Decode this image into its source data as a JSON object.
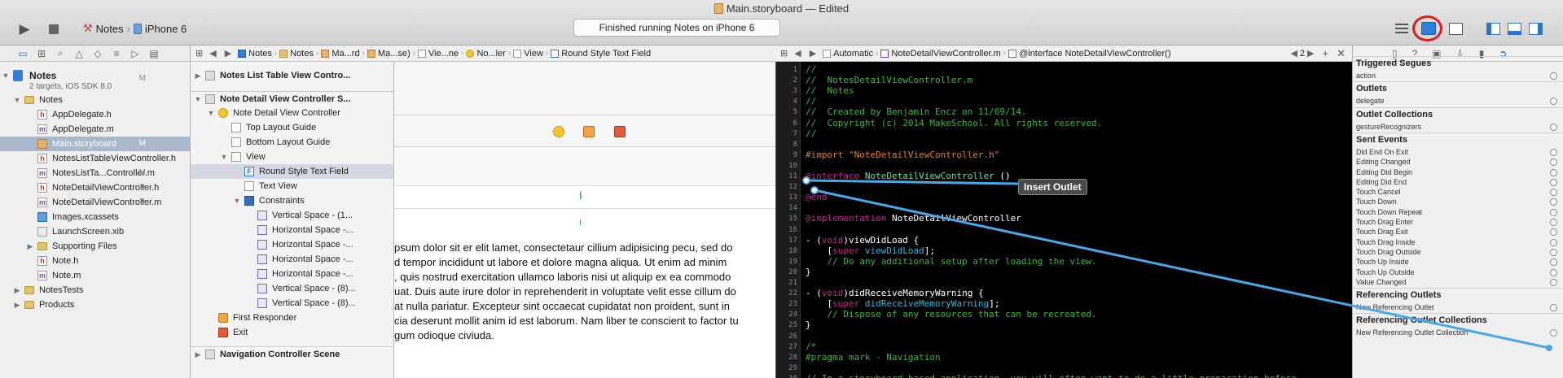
{
  "window": {
    "title": "Main.storyboard — Edited"
  },
  "toolbar": {
    "scheme_app": "Notes",
    "scheme_device": "iPhone 6",
    "activity_status": "Finished running Notes on iPhone 6"
  },
  "navigator": {
    "items": [
      {
        "label": "Notes",
        "sub": "2 targets, iOS SDK 8.0",
        "badge": "M"
      },
      {
        "label": "Notes",
        "badge": ""
      },
      {
        "label": "AppDelegate.h",
        "badge": ""
      },
      {
        "label": "AppDelegate.m",
        "badge": ""
      },
      {
        "label": "Main.storyboard",
        "badge": "M"
      },
      {
        "label": "NotesListTableViewController.h",
        "badge": ""
      },
      {
        "label": "NotesListTa...Controller.m",
        "badge": "M"
      },
      {
        "label": "NoteDetailViewController.h",
        "badge": "A"
      },
      {
        "label": "NoteDetailViewController.m",
        "badge": "A"
      },
      {
        "label": "Images.xcassets",
        "badge": ""
      },
      {
        "label": "LaunchScreen.xib",
        "badge": ""
      },
      {
        "label": "Supporting Files",
        "badge": ""
      },
      {
        "label": "Note.h",
        "badge": ""
      },
      {
        "label": "Note.m",
        "badge": ""
      },
      {
        "label": "NotesTests",
        "badge": ""
      },
      {
        "label": "Products",
        "badge": ""
      }
    ]
  },
  "ib_jumpbar": {
    "items": [
      "Notes",
      "Notes",
      "Ma...rd",
      "Ma...se)",
      "Vie...ne",
      "No...ler",
      "View",
      "Round Style Text Field"
    ]
  },
  "outline": {
    "items": [
      {
        "label": "Notes List Table View Contro..."
      },
      {
        "label": "Note Detail View Controller S..."
      },
      {
        "label": "Note Detail View Controller"
      },
      {
        "label": "Top Layout Guide"
      },
      {
        "label": "Bottom Layout Guide"
      },
      {
        "label": "View"
      },
      {
        "label": "Round Style Text Field"
      },
      {
        "label": "Text View"
      },
      {
        "label": "Constraints"
      },
      {
        "label": "Vertical Space - (1..."
      },
      {
        "label": "Horizontal Space -..."
      },
      {
        "label": "Horizontal Space -..."
      },
      {
        "label": "Horizontal Space -..."
      },
      {
        "label": "Horizontal Space -..."
      },
      {
        "label": "Vertical Space - (8)..."
      },
      {
        "label": "Vertical Space - (8)..."
      },
      {
        "label": "First Responder"
      },
      {
        "label": "Exit"
      },
      {
        "label": "Navigation Controller Scene"
      }
    ]
  },
  "canvas": {
    "text_lines": [
      "psum dolor sit er elit lamet, consectetaur cillium adipisicing pecu, sed do",
      "d tempor incididunt ut labore et dolore magna aliqua. Ut enim ad minim",
      ", quis nostrud exercitation ullamco laboris nisi ut aliquip ex ea commodo",
      "uat. Duis aute irure dolor in reprehenderit in voluptate velit esse cillum do",
      "at nulla pariatur. Excepteur sint occaecat cupidatat non proident, sunt in",
      "cia deserunt mollit anim id est laborum. Nam liber te conscient to factor tu",
      "gum odioque civiuda."
    ]
  },
  "code_jumpbar": {
    "mode": "Automatic",
    "file": "NoteDetailViewController.m",
    "symbol": "@interface NoteDetailViewController()",
    "counter": "2"
  },
  "code": {
    "lines": [
      {
        "n": "1",
        "parts": [
          {
            "c": "c-com",
            "t": "//"
          }
        ]
      },
      {
        "n": "2",
        "parts": [
          {
            "c": "c-com",
            "t": "//  NotesDetailViewController.m"
          }
        ]
      },
      {
        "n": "3",
        "parts": [
          {
            "c": "c-com",
            "t": "//  Notes"
          }
        ]
      },
      {
        "n": "4",
        "parts": [
          {
            "c": "c-com",
            "t": "//"
          }
        ]
      },
      {
        "n": "5",
        "parts": [
          {
            "c": "c-com",
            "t": "//  Created by Benjamin Encz on 11/09/14."
          }
        ]
      },
      {
        "n": "6",
        "parts": [
          {
            "c": "c-com",
            "t": "//  Copyright (c) 2014 MakeSchool. All rights reserved."
          }
        ]
      },
      {
        "n": "7",
        "parts": [
          {
            "c": "c-com",
            "t": "//"
          }
        ]
      },
      {
        "n": "8",
        "parts": []
      },
      {
        "n": "9",
        "parts": [
          {
            "c": "c-pre",
            "t": "#import "
          },
          {
            "c": "c-str",
            "t": "\"NoteDetailViewController.h\""
          }
        ]
      },
      {
        "n": "10",
        "parts": []
      },
      {
        "n": "11",
        "parts": [
          {
            "c": "c-at",
            "t": "@interface "
          },
          {
            "c": "c-cls",
            "t": "NoteDetailViewController"
          },
          {
            "c": "",
            "t": " ()"
          }
        ]
      },
      {
        "n": "12",
        "parts": []
      },
      {
        "n": "13",
        "parts": [
          {
            "c": "c-at",
            "t": "@end"
          }
        ]
      },
      {
        "n": "14",
        "parts": []
      },
      {
        "n": "15",
        "parts": [
          {
            "c": "c-at",
            "t": "@implementation "
          },
          {
            "c": "",
            "t": "NoteDetailViewController"
          }
        ]
      },
      {
        "n": "16",
        "parts": []
      },
      {
        "n": "17",
        "parts": [
          {
            "c": "",
            "t": "- ("
          },
          {
            "c": "c-kw",
            "t": "void"
          },
          {
            "c": "",
            "t": ")viewDidLoad {"
          }
        ]
      },
      {
        "n": "18",
        "parts": [
          {
            "c": "",
            "t": "    ["
          },
          {
            "c": "c-kw",
            "t": "super"
          },
          {
            "c": "c-sup",
            "t": " viewDidLoad"
          },
          {
            "c": "",
            "t": "];"
          }
        ]
      },
      {
        "n": "19",
        "parts": [
          {
            "c": "c-com",
            "t": "    // Do any additional setup after loading the view."
          }
        ]
      },
      {
        "n": "20",
        "parts": [
          {
            "c": "",
            "t": "}"
          }
        ]
      },
      {
        "n": "21",
        "parts": []
      },
      {
        "n": "22",
        "parts": [
          {
            "c": "",
            "t": "- ("
          },
          {
            "c": "c-kw",
            "t": "void"
          },
          {
            "c": "",
            "t": ")didReceiveMemoryWarning {"
          }
        ]
      },
      {
        "n": "23",
        "parts": [
          {
            "c": "",
            "t": "    ["
          },
          {
            "c": "c-kw",
            "t": "super"
          },
          {
            "c": "c-sup",
            "t": " didReceiveMemoryWarning"
          },
          {
            "c": "",
            "t": "];"
          }
        ]
      },
      {
        "n": "24",
        "parts": [
          {
            "c": "c-com",
            "t": "    // Dispose of any resources that can be recreated."
          }
        ]
      },
      {
        "n": "25",
        "parts": [
          {
            "c": "",
            "t": "}"
          }
        ]
      },
      {
        "n": "26",
        "parts": []
      },
      {
        "n": "27",
        "parts": [
          {
            "c": "c-com",
            "t": "/*"
          }
        ]
      },
      {
        "n": "28",
        "parts": [
          {
            "c": "c-com",
            "t": "#pragma mark - Navigation"
          }
        ]
      },
      {
        "n": "29",
        "parts": []
      },
      {
        "n": "30",
        "parts": [
          {
            "c": "c-com",
            "t": "// In a storyboard-based application, you will often want to do a little preparation before"
          }
        ]
      }
    ],
    "insert_outlet_label": "Insert Outlet"
  },
  "inspector": {
    "rows": [
      {
        "type": "head",
        "label": "Triggered Segues"
      },
      {
        "type": "row",
        "label": "action"
      },
      {
        "type": "head",
        "label": "Outlets"
      },
      {
        "type": "row",
        "label": "delegate"
      },
      {
        "type": "head",
        "label": "Outlet Collections"
      },
      {
        "type": "row",
        "label": "gestureRecognizers"
      },
      {
        "type": "head",
        "label": "Sent Events"
      },
      {
        "type": "row",
        "label": "Did End On Exit"
      },
      {
        "type": "row",
        "label": "Editing Changed"
      },
      {
        "type": "row",
        "label": "Editing Did Begin"
      },
      {
        "type": "row",
        "label": "Editing Did End"
      },
      {
        "type": "row",
        "label": "Touch Cancel"
      },
      {
        "type": "row",
        "label": "Touch Down"
      },
      {
        "type": "row",
        "label": "Touch Down Repeat"
      },
      {
        "type": "row",
        "label": "Touch Drag Enter"
      },
      {
        "type": "row",
        "label": "Touch Drag Exit"
      },
      {
        "type": "row",
        "label": "Touch Drag Inside"
      },
      {
        "type": "row",
        "label": "Touch Drag Outside"
      },
      {
        "type": "row",
        "label": "Touch Up Inside"
      },
      {
        "type": "row",
        "label": "Touch Up Outside"
      },
      {
        "type": "row",
        "label": "Value Changed"
      },
      {
        "type": "head",
        "label": "Referencing Outlets"
      },
      {
        "type": "row",
        "label": "New Referencing Outlet"
      },
      {
        "type": "head",
        "label": "Referencing Outlet Collections"
      },
      {
        "type": "row",
        "label": "New Referencing Outlet Collection"
      }
    ]
  },
  "colors": {
    "accent": "#2f72c8",
    "highlight_circle": "#d42020",
    "connection_line": "#4aa8e8"
  }
}
